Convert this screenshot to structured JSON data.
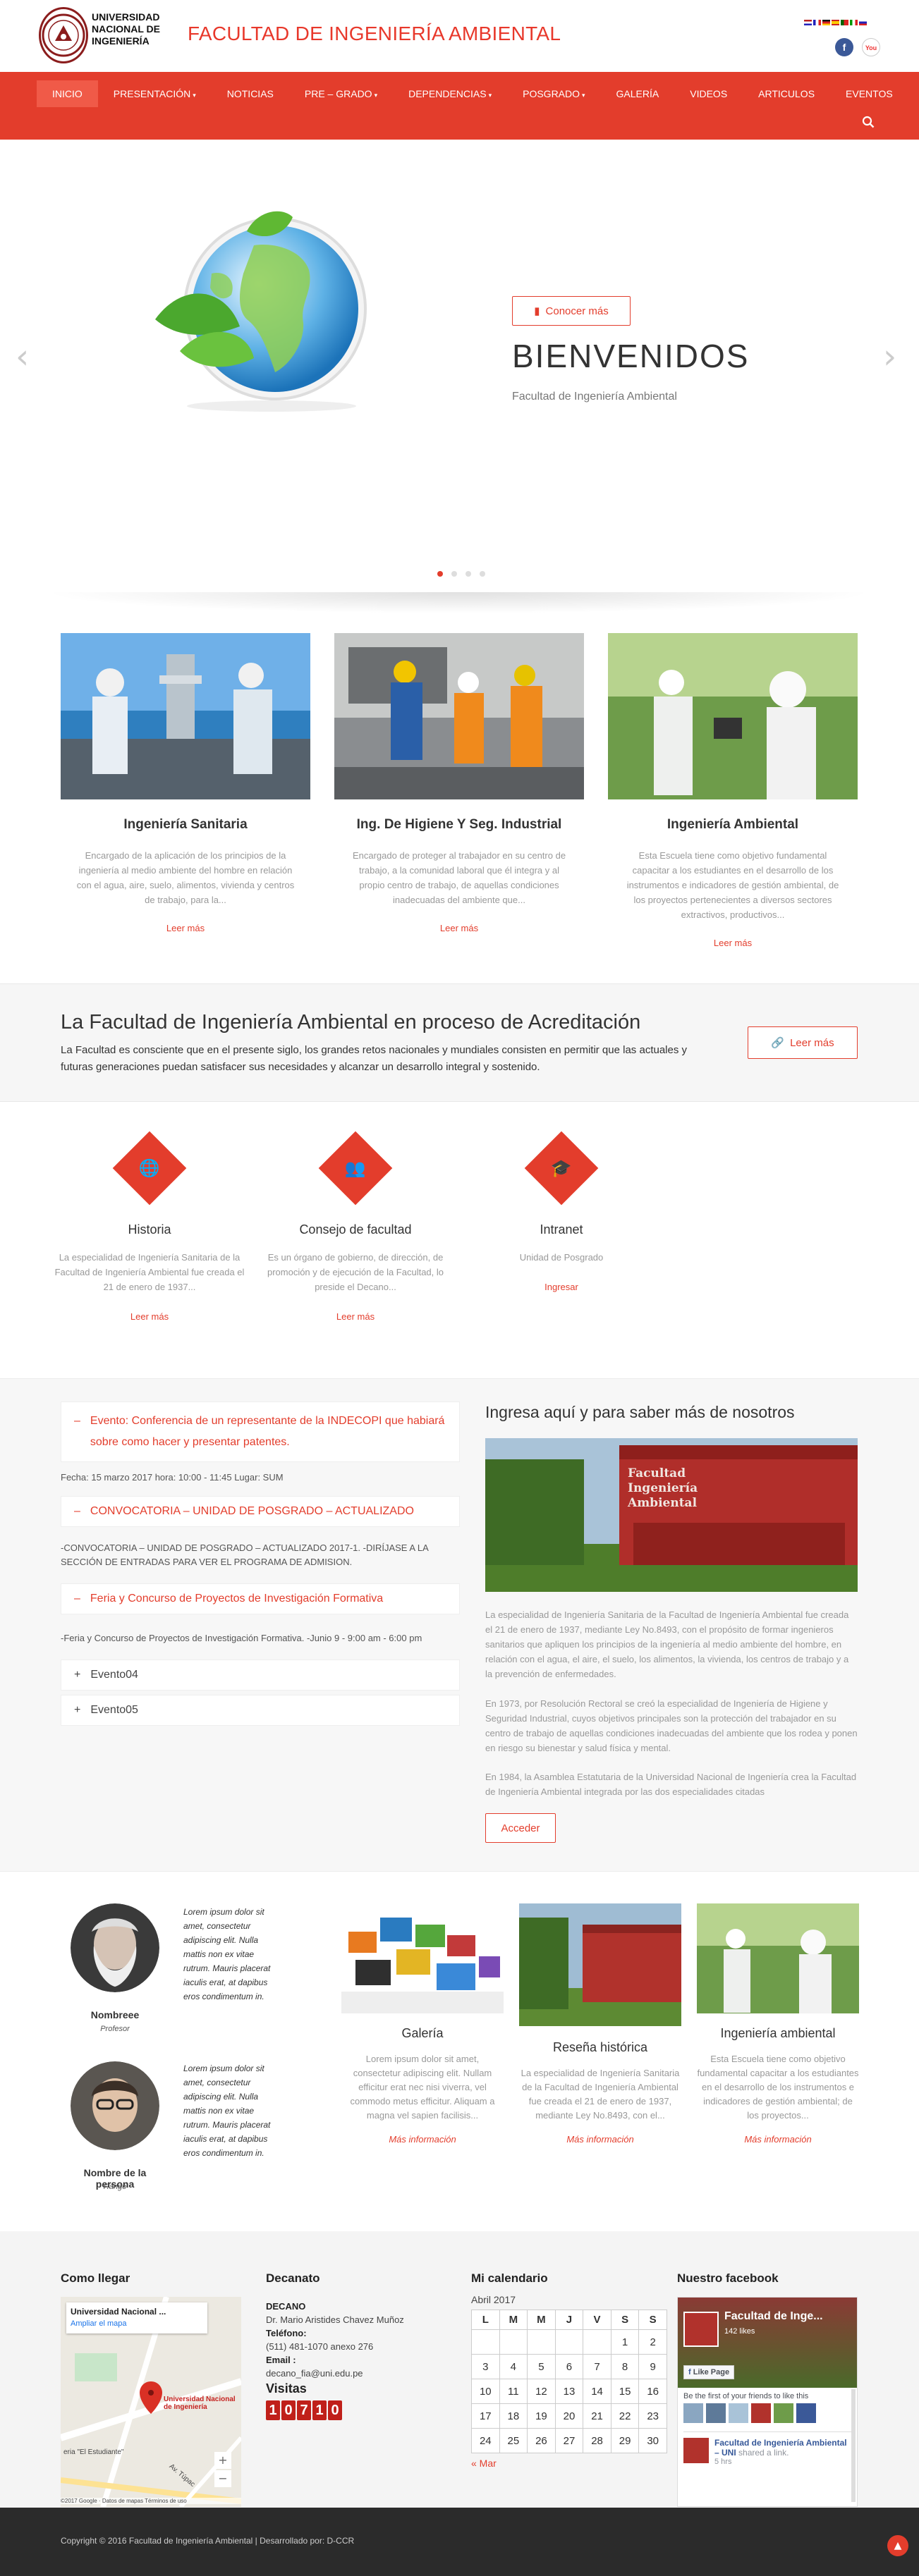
{
  "header": {
    "logo_text": "UNIVERSIDAD NACIONAL DE INGENIERÍA",
    "site_title": "FACULTAD DE INGENIERÍA AMBIENTAL",
    "social": {
      "facebook": "f",
      "youtube": "You"
    }
  },
  "nav": {
    "items": [
      {
        "label": "INICIO",
        "active": true,
        "dropdown": false
      },
      {
        "label": "PRESENTACIÓN",
        "active": false,
        "dropdown": true
      },
      {
        "label": "NOTICIAS",
        "active": false,
        "dropdown": false
      },
      {
        "label": "PRE – GRADO",
        "active": false,
        "dropdown": true
      },
      {
        "label": "DEPENDENCIAS",
        "active": false,
        "dropdown": true
      },
      {
        "label": "POSGRADO",
        "active": false,
        "dropdown": true
      },
      {
        "label": "GALERÍA",
        "active": false,
        "dropdown": false
      },
      {
        "label": "VIDEOS",
        "active": false,
        "dropdown": false
      },
      {
        "label": "ARTICULOS",
        "active": false,
        "dropdown": false
      },
      {
        "label": "EVENTOS",
        "active": false,
        "dropdown": false
      }
    ]
  },
  "hero": {
    "title": "BIENVENIDOS",
    "subtitle": "Facultad de Ingeniería Ambiental",
    "button": "Conocer más",
    "slides": 4,
    "active_slide": 1
  },
  "schools": [
    {
      "title": "Ingeniería Sanitaria",
      "text": "Encargado de la aplicación de los principios de la ingeniería al medio ambiente del hombre en relación con el agua, aire, suelo, alimentos, vivienda y centros de trabajo, para la...",
      "link": "Leer más"
    },
    {
      "title": "Ing. De Higiene Y Seg. Industrial",
      "text": "Encargado de proteger al trabajador en su centro de trabajo, a la comunidad laboral que él integra y al propio centro de trabajo, de aquellas condiciones inadecuadas del ambiente que...",
      "link": "Leer más"
    },
    {
      "title": "Ingeniería Ambiental",
      "text": "Esta Escuela tiene como objetivo fundamental capacitar a los estudiantes en el desarrollo de los instrumentos e indicadores de gestión ambiental, de los proyectos pertenecientes a diversos sectores extractivos, productivos...",
      "link": "Leer más"
    }
  ],
  "accreditation": {
    "title": "La Facultad de Ingeniería Ambiental en proceso de Acreditación",
    "text": "La Facultad es consciente que en el presente siglo, los grandes retos nacionales y mundiales consisten en permitir que las actuales y futuras generaciones puedan satisfacer sus necesidades y alcanzar un desarrollo integral y sostenido.",
    "button": "Leer más"
  },
  "services": [
    {
      "icon": "globe-icon",
      "glyph": "🌐",
      "title": "Historia",
      "text": "La especialidad de Ingeniería Sanitaria de la Facultad de Ingeniería Ambiental fue creada el 21 de enero de 1937...",
      "link": "Leer más"
    },
    {
      "icon": "people-icon",
      "glyph": "👥",
      "title": "Consejo de facultad",
      "text": "Es un órgano de gobierno, de dirección, de promoción y de ejecución de la Facultad, lo preside el Decano...",
      "link": "Leer más"
    },
    {
      "icon": "graduation-cap-icon",
      "glyph": "🎓",
      "title": "Intranet",
      "text": "Unidad de Posgrado",
      "link": "Ingresar"
    }
  ],
  "events": [
    {
      "title": "Evento: Conferencia de un representante de la INDECOPI que habiará sobre como hacer y presentar patentes.",
      "body": "Fecha: 15 marzo 2017 hora: 10:00 - 11:45 Lugar: SUM"
    },
    {
      "title": "CONVOCATORIA – UNIDAD DE POSGRADO – ACTUALIZADO",
      "body": "-CONVOCATORIA – UNIDAD DE POSGRADO – ACTUALIZADO 2017-1. -DIRÍJASE A LA SECCIÓN DE ENTRADAS PARA VER EL PROGRAMA DE ADMISION."
    },
    {
      "title": "Feria y Concurso de Proyectos de Investigación Formativa",
      "body": "-Feria y Concurso de Proyectos de Investigación Formativa. -Junio 9 - 9:00 am - 6:00 pm"
    },
    {
      "title": "Evento04",
      "body": ""
    },
    {
      "title": "Evento05",
      "body": ""
    }
  ],
  "about": {
    "title": "Ingresa aquí y para saber más de nosotros",
    "p1": "La especialidad de Ingeniería Sanitaria de la Facultad de Ingeniería Ambiental fue creada el 21 de enero de 1937, mediante Ley No.8493, con el propósito de formar ingenieros sanitarios que apliquen los principios de la ingeniería al medio ambiente del hombre, en relación con el agua, el aire, el suelo, los alimentos, la vivienda, los centros de trabajo y a la prevención de enfermedades.",
    "p2": "En 1973, por Resolución Rectoral se creó la especialidad de Ingeniería de Higiene y Seguridad Industrial, cuyos objetivos principales son la protección del trabajador en su centro de trabajo de aquellas condiciones inadecuadas del ambiente que los rodea y ponen en riesgo su bienestar y salud física y mental.",
    "p3": "En 1984, la Asamblea Estatutaria de la Universidad Nacional de Ingeniería crea la Facultad de Ingeniería Ambiental integrada por las dos especialidades citadas",
    "button": "Acceder",
    "sign_text": "Facultad Ingeniería Ambiental"
  },
  "team": [
    {
      "quote": "Lorem ipsum dolor sit amet, consectetur adipiscing elit. Nulla mattis non ex vitae rutrum. Mauris placerat iaculis erat, at dapibus eros condimentum in.",
      "name": "Nombreee",
      "role": "Profesor"
    },
    {
      "quote": "Lorem ipsum dolor sit amet, consectetur adipiscing elit. Nulla mattis non ex vitae rutrum. Mauris placerat iaculis erat, at dapibus eros condimentum in.",
      "name": "Nombre de la persona",
      "role": "Rango"
    }
  ],
  "features": [
    {
      "title": "Galería",
      "text": "Lorem ipsum dolor sit amet, consectetur adipiscing elit. Nullam efficitur erat nec nisi viverra, vel commodo metus efficitur. Aliquam a magna vel sapien facilisis...",
      "link": "Más información"
    },
    {
      "title": "Reseña histórica",
      "text": "La especialidad de Ingeniería Sanitaria de la Facultad de Ingeniería Ambiental fue creada el 21 de enero de 1937, mediante Ley No.8493, con el...",
      "link": "Más información"
    },
    {
      "title": "Ingeniería ambiental",
      "text": "Esta Escuela tiene como objetivo fundamental capacitar a los estudiantes en el desarrollo de los instrumentos e indicadores de gestión ambiental; de los proyectos...",
      "link": "Más información"
    }
  ],
  "footer": {
    "map_title": "Como llegar",
    "map_place": "Universidad Nacional ...",
    "map_link": "Ampliar el mapa",
    "map_pin_label": "Universidad Nacional de Ingeniería",
    "map_street": "Av. Túpac",
    "map_area": "eria \"El Estudiante\"",
    "map_credit": "©2017 Google · Datos de mapas   Términos de uso",
    "dean_title": "Decanato",
    "dean_label": "DECANO",
    "dean_name": "Dr. Mario Aristides Chavez Muñoz",
    "phone_label": "Teléfono:",
    "phone": "(511) 481-1070 anexo 276",
    "email_label": "Email :",
    "email": "decano_fia@uni.edu.pe",
    "visits_label": "Visitas",
    "visits": [
      "1",
      "0",
      "7",
      "1",
      "0"
    ],
    "cal_title": "Mi calendario",
    "cal_month": "Abril 2017",
    "cal_days": [
      "L",
      "M",
      "M",
      "J",
      "V",
      "S",
      "S"
    ],
    "cal_weeks": [
      [
        "",
        "",
        "",
        "",
        "",
        "1",
        "2"
      ],
      [
        "3",
        "4",
        "5",
        "6",
        "7",
        "8",
        "9"
      ],
      [
        "10",
        "11",
        "12",
        "13",
        "14",
        "15",
        "16"
      ],
      [
        "17",
        "18",
        "19",
        "20",
        "21",
        "22",
        "23"
      ],
      [
        "24",
        "25",
        "26",
        "27",
        "28",
        "29",
        "30"
      ]
    ],
    "cal_prev": "« Mar",
    "fb_title": "Nuestro facebook",
    "fb_page": "Facultad de Inge...",
    "fb_likes": "142 likes",
    "fb_like_btn": "Like Page",
    "fb_first": "Be the first of your friends to like this",
    "fb_post_name": "Facultad de Ingeniería Ambiental – UNI",
    "fb_post_action": "shared a link.",
    "fb_post_time": "5 hrs"
  },
  "bottom": {
    "copyright": "Copyright © 2016 Facultad de Ingeniería Ambiental | Desarrollado por: D-CCR"
  },
  "colors": {
    "accent": "#e33d2c",
    "dark": "#2b2b2b"
  }
}
